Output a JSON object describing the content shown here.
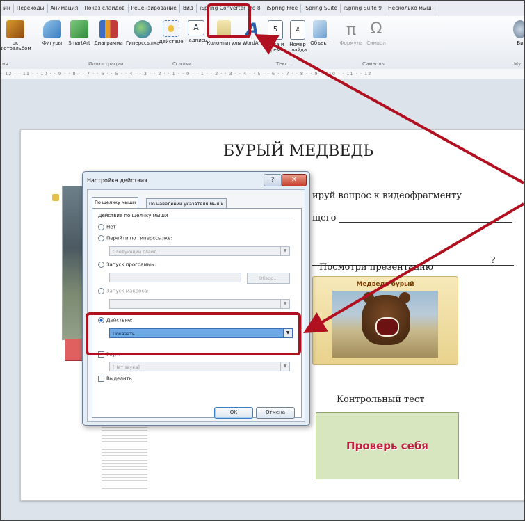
{
  "ribbon": {
    "tabs": [
      "йн",
      "Переходы",
      "Анимация",
      "Показ слайдов",
      "Рецензирование",
      "Вид",
      "iSpring Converter Pro 8",
      "iSpring Free",
      "iSpring Suite",
      "iSpring Suite 9",
      "Несколько мыш"
    ],
    "items": [
      {
        "label": "ок Фотоальбом",
        "icon": "photo-album-icon"
      },
      {
        "label": "Фигуры",
        "icon": "shapes-icon"
      },
      {
        "label": "SmartArt",
        "icon": "smartart-icon"
      },
      {
        "label": "Диаграмма",
        "icon": "chart-icon"
      },
      {
        "label": "Гиперссылка",
        "icon": "hyperlink-icon"
      },
      {
        "label": "Действие",
        "icon": "action-icon"
      },
      {
        "label": "Надпись",
        "icon": "textbox-icon"
      },
      {
        "label": "Колонтитулы",
        "icon": "header-footer-icon"
      },
      {
        "label": "WordArt",
        "icon": "wordart-icon"
      },
      {
        "label": "Дата и время",
        "icon": "date-time-icon"
      },
      {
        "label": "Номер слайда",
        "icon": "slide-number-icon"
      },
      {
        "label": "Объект",
        "icon": "object-icon"
      },
      {
        "label": "Формула",
        "icon": "formula-icon"
      },
      {
        "label": "Символ",
        "icon": "symbol-icon"
      },
      {
        "label": "Ви",
        "icon": "video-icon"
      }
    ],
    "groups": [
      "ия",
      "Иллюстрации",
      "Ссылки",
      "Текст",
      "Символы",
      "Му"
    ],
    "ruler": "· 12 · · 11 · · 10 · · 9 · · 8 · · 7 · · 6 · · 5 · · 4 · · 3 · · 2 · · 1 · · 0 · · 1 · · 2 · · 3 · · 4 · · 5 · · 6 · · 7 · · 8 · · 9 · · 10 · · 11 · · 12"
  },
  "slide": {
    "title": "БУРЫЙ МЕДВЕДЬ",
    "question_line1": "ируй вопрос к видеофрагменту",
    "question_line2": "щего",
    "question_mark": "?",
    "presentation_label": "Посмотри презентацию",
    "bear_card_title": "Медведь бурый",
    "test_label": "Контрольный тест",
    "check_button": "Проверь себя"
  },
  "dialog": {
    "title": "Настройка действия",
    "help": "?",
    "close": "✕",
    "tabs": [
      "По щелчку мыши",
      "По наведении указателя мыши"
    ],
    "group_label": "Действие по щелчку мыши",
    "radio_none": "Нет",
    "radio_hyperlink": "Перейти по гиперссылке:",
    "hyperlink_value": "Следующий слайд",
    "radio_program": "Запуск программы:",
    "browse": "Обзор...",
    "radio_macro": "Запуск макроса:",
    "radio_action": "Действие:",
    "action_value": "Показать",
    "sound_label": "Звук:",
    "sound_value": "[Нет звука]",
    "highlight_label": "Выделить",
    "ok": "ОК",
    "cancel": "Отмена"
  },
  "colors": {
    "callout": "#b01020",
    "selection": "#6fa9e6"
  }
}
